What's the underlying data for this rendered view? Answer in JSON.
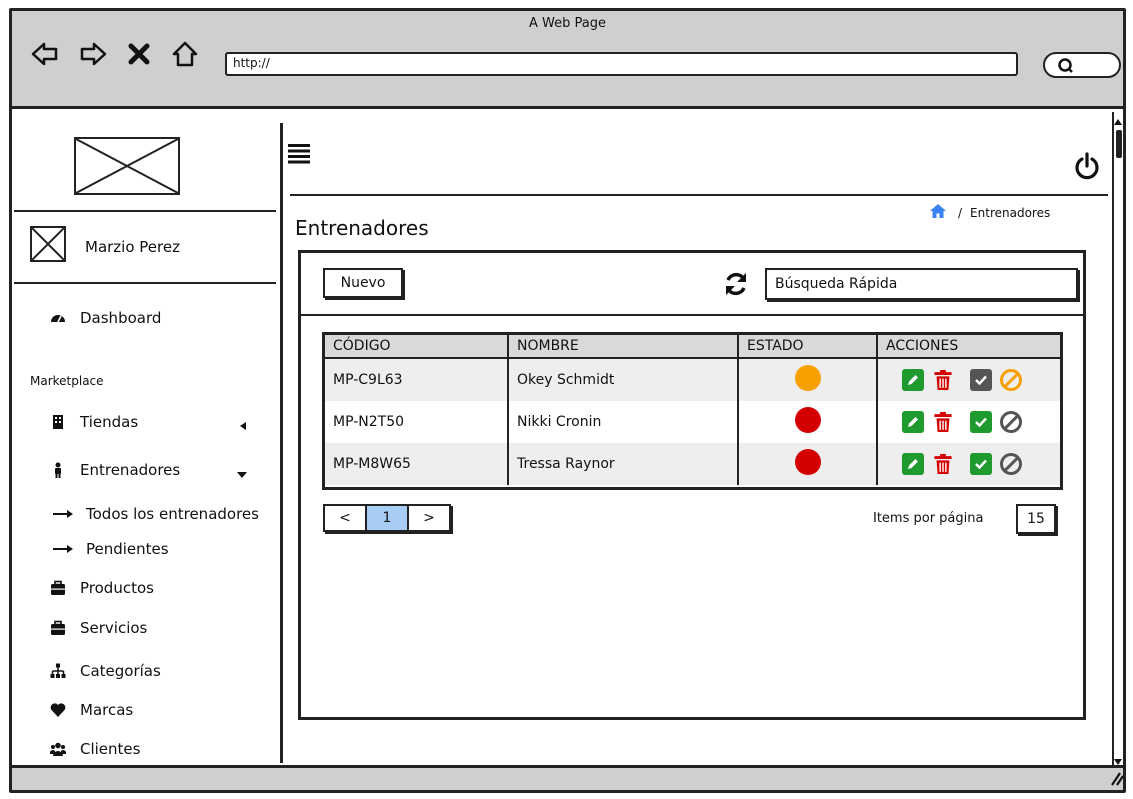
{
  "window": {
    "title": "A Web Page"
  },
  "browser": {
    "url": "http://"
  },
  "sidebar": {
    "user_name": "Marzio Perez",
    "dashboard": "Dashboard",
    "section": "Marketplace",
    "items": [
      {
        "label": "Tiendas",
        "icon": "store-icon"
      },
      {
        "label": "Entrenadores",
        "icon": "person-icon"
      },
      {
        "label": "Todos los entrenadores",
        "icon": "arrow-right-icon"
      },
      {
        "label": "Pendientes",
        "icon": "arrow-right-icon"
      },
      {
        "label": "Productos",
        "icon": "briefcase-icon"
      },
      {
        "label": "Servicios",
        "icon": "briefcase-icon"
      },
      {
        "label": "Categorías",
        "icon": "sitemap-icon"
      },
      {
        "label": "Marcas",
        "icon": "heart-icon"
      },
      {
        "label": "Clientes",
        "icon": "users-icon"
      }
    ]
  },
  "main": {
    "title": "Entrenadores",
    "breadcrumb": {
      "separator": "/",
      "current": "Entrenadores"
    },
    "new_button": "Nuevo",
    "search_placeholder": "Búsqueda Rápida",
    "table": {
      "headers": [
        "CÓDIGO",
        "NOMBRE",
        "ESTADO",
        "ACCIONES"
      ],
      "rows": [
        {
          "code": "MP-C9L63",
          "name": "Okey Schmidt",
          "status_color": "#f7a000",
          "check_color": "#555555",
          "block_color": "#f7a000"
        },
        {
          "code": "MP-N2T50",
          "name": "Nikki Cronin",
          "status_color": "#d40000",
          "check_color": "#1f9a2e",
          "block_color": "#555555"
        },
        {
          "code": "MP-M8W65",
          "name": "Tressa Raynor",
          "status_color": "#d40000",
          "check_color": "#1f9a2e",
          "block_color": "#555555"
        }
      ]
    },
    "pager": {
      "prev": "<",
      "page": "1",
      "next": ">"
    },
    "items_label": "Items por página",
    "items_per_page": "15"
  },
  "colors": {
    "edit": "#1f9a2e",
    "delete": "#d40000",
    "page_active": "#a8cdf5"
  }
}
